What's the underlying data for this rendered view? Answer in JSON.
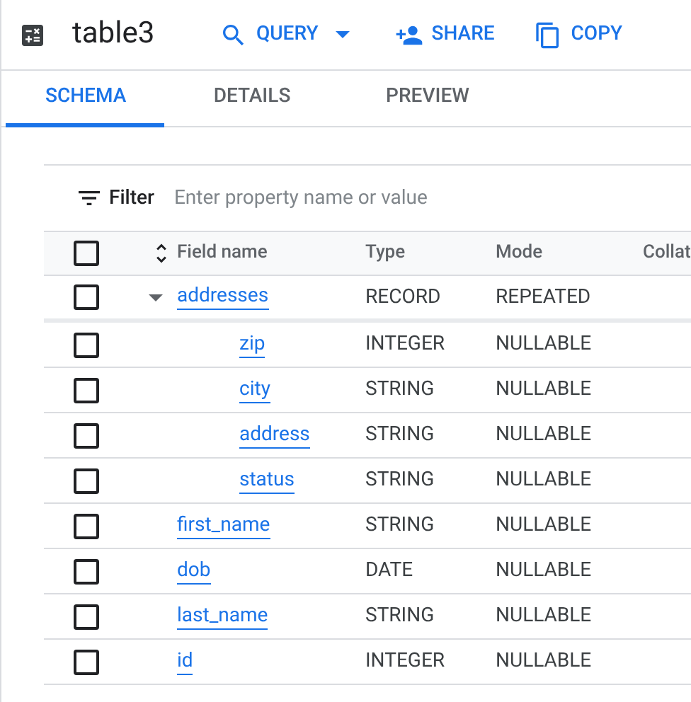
{
  "header": {
    "title": "table3",
    "actions": [
      {
        "label": "QUERY",
        "dropdown": true
      },
      {
        "label": "SHARE",
        "dropdown": false
      },
      {
        "label": "COPY",
        "dropdown": false
      }
    ]
  },
  "tabs": [
    {
      "label": "SCHEMA",
      "selected": true
    },
    {
      "label": "DETAILS",
      "selected": false
    },
    {
      "label": "PREVIEW",
      "selected": false
    }
  ],
  "filter": {
    "label": "Filter",
    "placeholder": "Enter property name or value"
  },
  "table": {
    "all_checked": false,
    "columns": [
      "Field name",
      "Type",
      "Mode",
      "Collat"
    ],
    "rows": [
      {
        "name": "addresses",
        "type": "RECORD",
        "mode": "REPEATED",
        "checked": false,
        "expanded": true,
        "children": [
          {
            "name": "zip",
            "type": "INTEGER",
            "mode": "NULLABLE",
            "checked": false
          },
          {
            "name": "city",
            "type": "STRING",
            "mode": "NULLABLE",
            "checked": false
          },
          {
            "name": "address",
            "type": "STRING",
            "mode": "NULLABLE",
            "checked": false
          },
          {
            "name": "status",
            "type": "STRING",
            "mode": "NULLABLE",
            "checked": false
          }
        ]
      },
      {
        "name": "first_name",
        "type": "STRING",
        "mode": "NULLABLE",
        "checked": false
      },
      {
        "name": "dob",
        "type": "DATE",
        "mode": "NULLABLE",
        "checked": false
      },
      {
        "name": "last_name",
        "type": "STRING",
        "mode": "NULLABLE",
        "checked": false
      },
      {
        "name": "id",
        "type": "INTEGER",
        "mode": "NULLABLE",
        "checked": false
      }
    ]
  }
}
